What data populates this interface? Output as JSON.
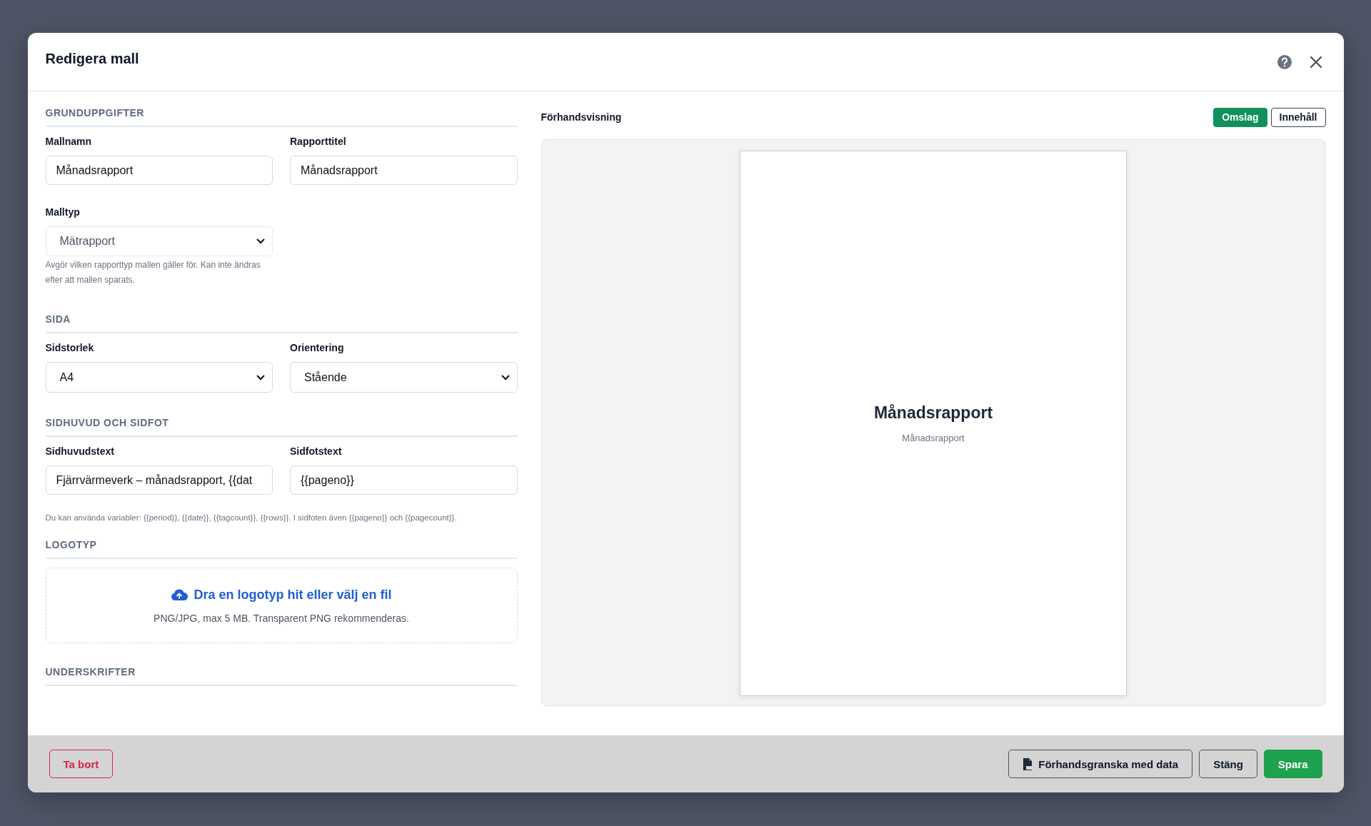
{
  "dialog": {
    "title": "Redigera mall"
  },
  "sections": [
    {
      "heading": "GRUNDUPPGIFTER",
      "fields": [
        {
          "label": "Mallnamn",
          "kind": "input",
          "value": "Månadsrapport"
        },
        {
          "label": "Rapporttitel",
          "kind": "input",
          "value": "Månadsrapport"
        },
        {
          "label": "Malltyp",
          "kind": "select",
          "value": "Mätrapport",
          "help": "Avgör vilken rapporttyp mallen gäller för. Kan inte ändras efter att mallen sparats.",
          "disabled": true
        }
      ]
    },
    {
      "heading": "SIDA",
      "fields": [
        {
          "label": "Sidstorlek",
          "kind": "select",
          "value": "A4",
          "disabled": false
        },
        {
          "label": "Orientering",
          "kind": "select",
          "value": "Stående",
          "disabled": false
        }
      ]
    },
    {
      "heading": "SIDHUVUD OCH SIDFOT",
      "fields": [
        {
          "label": "Sidhuvudstext",
          "kind": "input",
          "value": "Fjärrvärmeverk – månadsrapport, {{dat"
        },
        {
          "label": "Sidfotstext",
          "kind": "input",
          "value": "{{pageno}}"
        }
      ],
      "note": "Du kan använda variabler: {{period}}, {{date}}, {{tagcount}}, {{rows}}. I sidfoten även {{pageno}} och {{pagecount}}."
    },
    {
      "heading": "LOGOTYP",
      "dropzone": {
        "action": "Dra en logotyp hit eller välj en fil",
        "hint": "PNG/JPG, max 5 MB. Transparent PNG rekommenderas."
      }
    },
    {
      "heading": "UNDERSKRIFTER"
    }
  ],
  "preview": {
    "label": "Förhandsvisning",
    "tabs": [
      {
        "label": "Omslag",
        "selected": true
      },
      {
        "label": "Innehåll",
        "selected": false
      }
    ],
    "page": {
      "title": "Månadsrapport",
      "subtitle": "Månadsrapport"
    }
  },
  "footer": {
    "delete": "Ta bort",
    "buttons": [
      {
        "label": "Förhandsgranska med data",
        "kind": "outline"
      },
      {
        "label": "Stäng",
        "kind": "outline"
      },
      {
        "label": "Spara",
        "kind": "primary"
      }
    ]
  }
}
